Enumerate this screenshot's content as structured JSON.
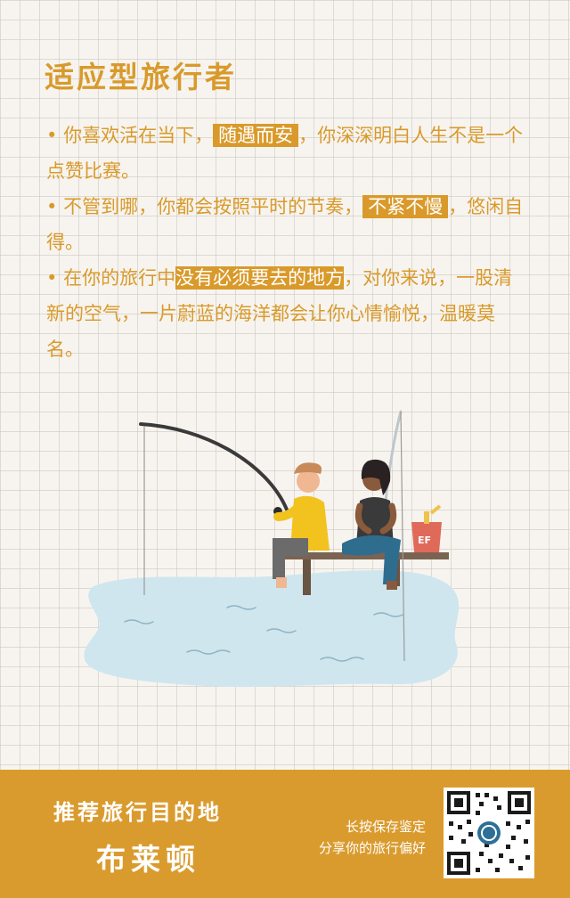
{
  "title": "适应型旅行者",
  "paragraphs": [
    {
      "bullet": "•",
      "pre": "你喜欢活在当下，",
      "highlight": "随遇而安",
      "post": "，你深深明白人生不是一个点赞比赛。"
    },
    {
      "bullet": "•",
      "pre": "不管到哪，你都会按照平时的节奏，",
      "highlight": "不紧不慢",
      "post": "，悠闲自得。"
    },
    {
      "bullet": "•",
      "pre": "在你的旅行中",
      "highlight": "没有必须要去的地方",
      "post": "，对你来说，一股清新的空气，一片蔚蓝的海洋都会让你心情愉悦，温暖莫名。"
    }
  ],
  "illustration": {
    "bucket_text": "EF"
  },
  "footer": {
    "label": "推荐旅行目的地",
    "destination": "布莱顿",
    "hint_line1": "长按保存鉴定",
    "hint_line2": "分享你的旅行偏好"
  },
  "colors": {
    "accent": "#d99a2b",
    "background": "#f7f4ef",
    "water": "#cfe6ef",
    "shirt_man": "#f2c21e",
    "bucket": "#e06a5a"
  }
}
